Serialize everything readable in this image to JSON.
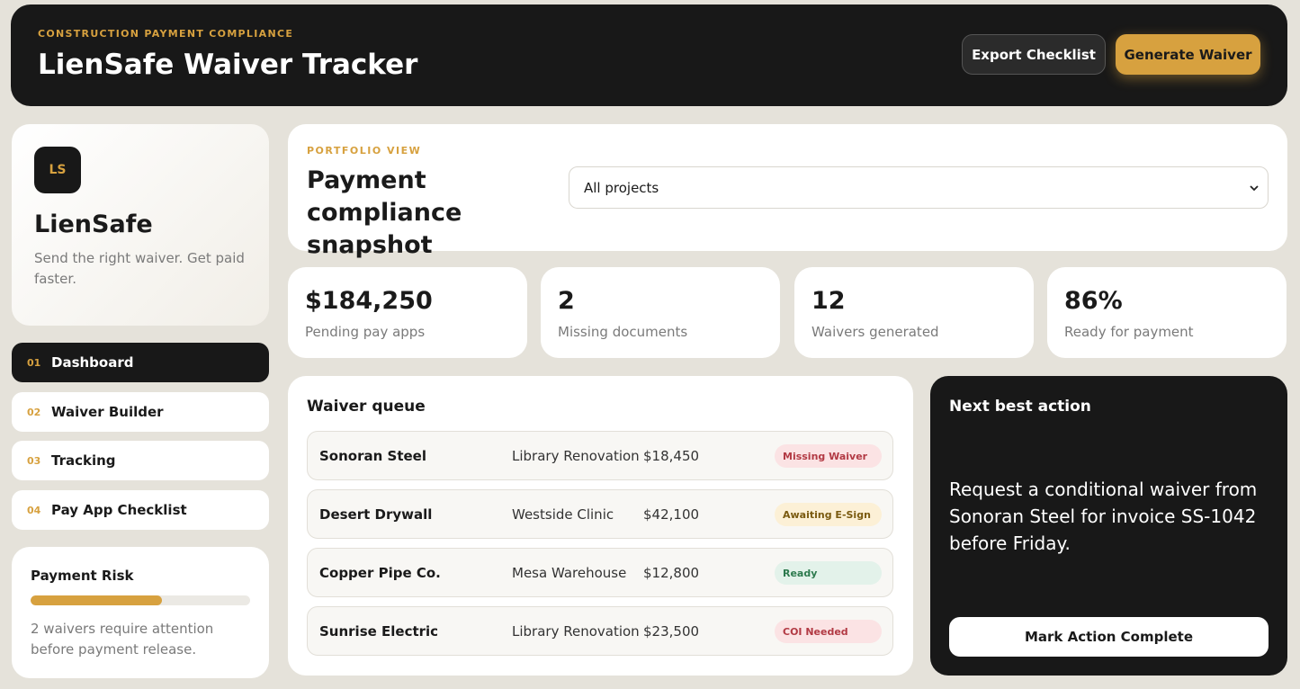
{
  "header": {
    "eyebrow": "CONSTRUCTION PAYMENT COMPLIANCE",
    "title": "LienSafe Waiver Tracker",
    "export_label": "Export Checklist",
    "generate_label": "Generate Waiver"
  },
  "brand": {
    "logo": "LS",
    "name": "LienSafe",
    "tagline": "Send the right waiver. Get paid faster."
  },
  "nav": {
    "items": [
      {
        "num": "01",
        "label": "Dashboard",
        "active": true
      },
      {
        "num": "02",
        "label": "Waiver Builder",
        "active": false
      },
      {
        "num": "03",
        "label": "Tracking",
        "active": false
      },
      {
        "num": "04",
        "label": "Pay App Checklist",
        "active": false
      }
    ]
  },
  "risk": {
    "title": "Payment Risk",
    "level_percent": 60,
    "note": "2 waivers require attention before payment release."
  },
  "portfolio": {
    "eyebrow": "PORTFOLIO VIEW",
    "title": "Payment compliance snapshot",
    "select_value": "All projects",
    "chevron_icon": "chevron-down-icon"
  },
  "stats": [
    {
      "value": "$184,250",
      "label": "Pending pay apps"
    },
    {
      "value": "2",
      "label": "Missing documents"
    },
    {
      "value": "12",
      "label": "Waivers generated"
    },
    {
      "value": "86%",
      "label": "Ready for payment"
    }
  ],
  "queue": {
    "title": "Waiver queue",
    "rows": [
      {
        "vendor": "Sonoran Steel",
        "project": "Library Renovation",
        "amount": "$18,450",
        "status": "Missing Waiver",
        "status_bg": "#fbe3e4",
        "status_color": "#b23a44"
      },
      {
        "vendor": "Desert Drywall",
        "project": "Westside Clinic",
        "amount": "$42,100",
        "status": "Awaiting E-Sign",
        "status_bg": "#fcf0d6",
        "status_color": "#7a5a10"
      },
      {
        "vendor": "Copper Pipe Co.",
        "project": "Mesa Warehouse",
        "amount": "$12,800",
        "status": "Ready",
        "status_bg": "#e3f2ea",
        "status_color": "#2d7a4e"
      },
      {
        "vendor": "Sunrise Electric",
        "project": "Library Renovation",
        "amount": "$23,500",
        "status": "COI Needed",
        "status_bg": "#fbe3e4",
        "status_color": "#b23a44"
      }
    ]
  },
  "action": {
    "title": "Next best action",
    "text": "Request a conditional waiver from Sonoran Steel for invoice SS-1042 before Friday.",
    "button_label": "Mark Action Complete"
  },
  "colors": {
    "accent": "#d7a13f",
    "dark": "#181818",
    "background": "#e5e2da"
  }
}
